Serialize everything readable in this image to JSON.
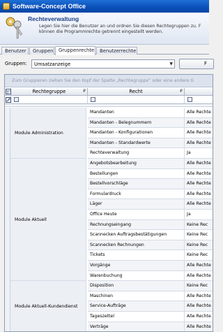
{
  "window": {
    "title": "Software-Concept Office"
  },
  "header": {
    "title": "Rechteverwaltung",
    "description_line1": "Legen Sie hier die Benutzer an und ordnen Sie diesen Rechtegruppen zu. F",
    "description_line2": "können die Programmrechte getrennt eingestellt werden."
  },
  "tabs": [
    "Benutzer",
    "Gruppen",
    "Gruppenrechte",
    "Benutzerrechte"
  ],
  "active_tab": "Gruppenrechte",
  "group_select": {
    "label": "Gruppen:",
    "value": "Umsatzanzeige",
    "button_label": "F"
  },
  "grid": {
    "group_panel_hint": "Zum Gruppieren ziehen Sie den Kopf der Spalte „Rechtegruppe“ oder eine andere G",
    "columns": [
      "Rechtegruppe",
      "Recht",
      ""
    ],
    "groups": [
      {
        "name": "Module Administration",
        "rows": [
          {
            "recht": "Mandanten",
            "wert": "Alle Rechte"
          },
          {
            "recht": "Mandanten - Belegnummern",
            "wert": "Alle Rechte"
          },
          {
            "recht": "Mandanten - Konfigurationen",
            "wert": "Alle Rechte"
          },
          {
            "recht": "Mandanten - Standardwerte",
            "wert": "Alle Rechte"
          },
          {
            "recht": "Rechteverwaltung",
            "wert": "Ja"
          }
        ]
      },
      {
        "name": "Module Aktuell",
        "rows": [
          {
            "recht": "Angebotsbearbeitung",
            "wert": "Alle Rechte"
          },
          {
            "recht": "Bestellungen",
            "wert": "Alle Rechte"
          },
          {
            "recht": "Bestellvorschläge",
            "wert": "Alle Rechte"
          },
          {
            "recht": "Formulardruck",
            "wert": "Alle Rechte"
          },
          {
            "recht": "Läger",
            "wert": "Alle Rechte"
          },
          {
            "recht": "Office Heute",
            "wert": "Ja"
          },
          {
            "recht": "Rechnungseingang",
            "wert": "Keine Rec"
          },
          {
            "recht": "Scannecken Auftragsbestätigungen",
            "wert": "Keine Rec"
          },
          {
            "recht": "Scannecken Rechnungen",
            "wert": "Keine Rec"
          },
          {
            "recht": "Tickets",
            "wert": "Keine Rec"
          },
          {
            "recht": "Vorgänge",
            "wert": "Alle Rechte"
          },
          {
            "recht": "Warenbuchung",
            "wert": "Alle Rechte"
          }
        ]
      },
      {
        "name": "Module Aktuell-Kundendienst",
        "rows": [
          {
            "recht": "Disposition",
            "wert": "Keine Rec"
          },
          {
            "recht": "Maschinen",
            "wert": "Alle Rechte"
          },
          {
            "recht": "Service-Aufträge",
            "wert": "Alle Rechte"
          },
          {
            "recht": "Tageszettel",
            "wert": "Alle Rechte"
          },
          {
            "recht": "Verträge",
            "wert": "Alle Rechte"
          }
        ]
      }
    ]
  }
}
